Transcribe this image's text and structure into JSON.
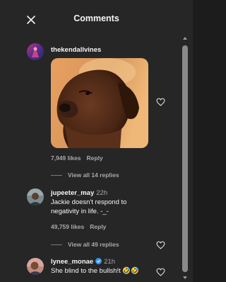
{
  "header": {
    "title": "Comments",
    "close_icon": "close-icon"
  },
  "comments": [
    {
      "username": "thekendallvines",
      "time": "",
      "text": "",
      "likes": "7,949 likes",
      "reply_label": "Reply",
      "view_replies": "View all 14 replies",
      "image": "dog-photo"
    },
    {
      "username": "jupeeter_may",
      "time": "22h",
      "text": "Jackie doesn't respond to negativity in life. -_-",
      "likes": "49,759 likes",
      "reply_label": "Reply",
      "view_replies": "View all 49 replies"
    },
    {
      "username": "lynee_monae",
      "time": "21h",
      "verified": true,
      "text": "She blind to the bullsh!t 🤣🤣",
      "likes": "",
      "reply_label": ""
    }
  ],
  "colors": {
    "background": "#262626",
    "text": "#f5f5f5",
    "muted": "#a8a8a8",
    "verified": "#3897f0"
  }
}
